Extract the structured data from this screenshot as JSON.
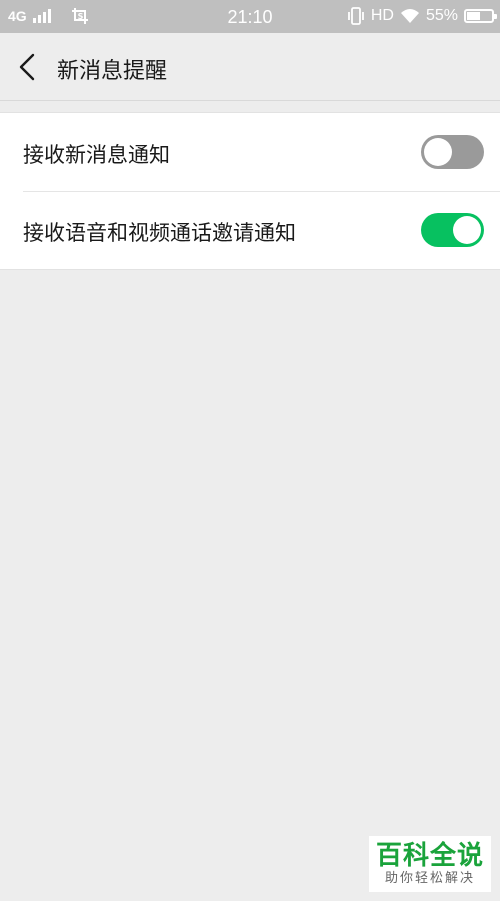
{
  "status_bar": {
    "network": "4G",
    "time": "21:10",
    "hd": "HD",
    "battery_text": "55%",
    "battery_level": 0.55,
    "icons": [
      "signal-icon",
      "screenshot-icon",
      "vibrate-icon",
      "wifi-icon",
      "battery-icon"
    ]
  },
  "nav": {
    "title": "新消息提醒",
    "back_icon": "chevron-left-icon"
  },
  "settings": [
    {
      "label": "接收新消息通知",
      "enabled": false
    },
    {
      "label": "接收语音和视频通话邀请通知",
      "enabled": true
    }
  ],
  "colors": {
    "status_bar_bg": "#bfbfbf",
    "background": "#ededed",
    "toggle_on": "#07c160",
    "toggle_off": "#9a9a9a",
    "watermark_green": "#1aa33b"
  },
  "watermark": {
    "title": "百科全说",
    "subtitle": "助你轻松解决"
  }
}
